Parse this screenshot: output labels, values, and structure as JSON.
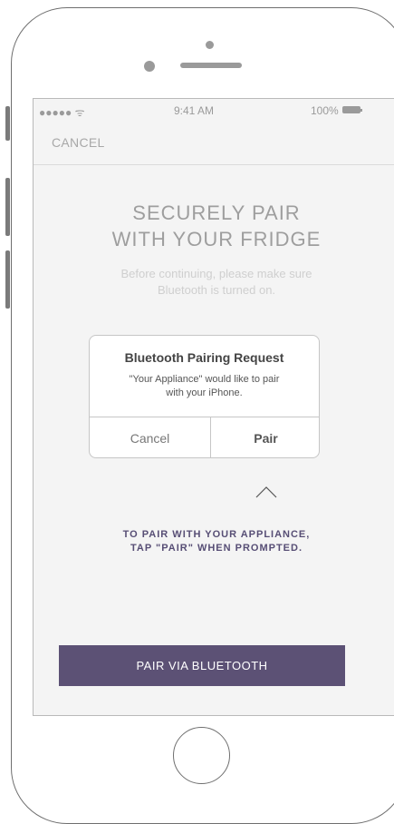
{
  "status_bar": {
    "signal": "●●●●● ᯤ",
    "time": "9:41 AM",
    "battery": "100%"
  },
  "nav": {
    "cancel": "CANCEL"
  },
  "heading": {
    "line1": "SECURELY PAIR",
    "line2": "WITH YOUR FRIDGE"
  },
  "subtitle": {
    "line1": "Before continuing, please make sure",
    "line2": "Bluetooth is turned on."
  },
  "dialog": {
    "title": "Bluetooth Pairing Request",
    "message_line1": "\"Your Appliance\" would like to pair",
    "message_line2": "with your iPhone.",
    "cancel": "Cancel",
    "pair": "Pair"
  },
  "instruction": {
    "line1": "TO PAIR WITH YOUR APPLIANCE,",
    "line2": "TAP \"PAIR\" WHEN PROMPTED."
  },
  "primary_button": "PAIR VIA BLUETOOTH",
  "colors": {
    "accent": "#5c5175",
    "instruction_text": "#574e75",
    "screen_bg": "#f4f4f4"
  }
}
